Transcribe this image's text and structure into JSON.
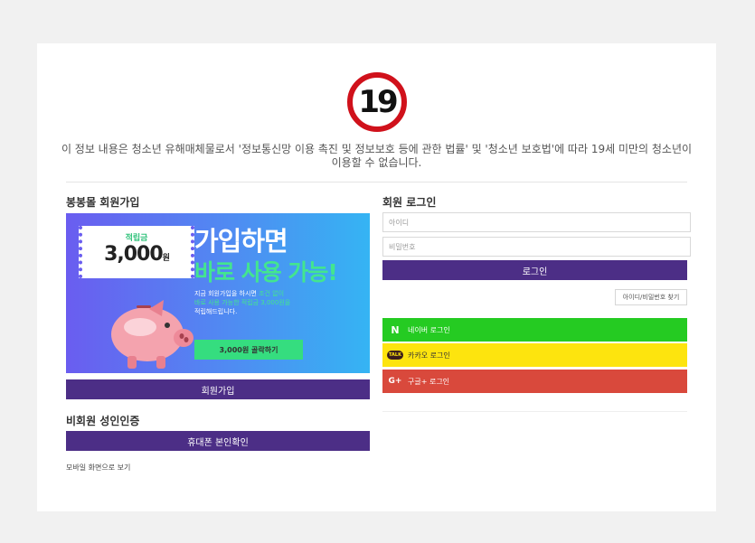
{
  "age_badge": "19",
  "notice": "이 정보 내용은 청소년 유해매체물로서 '정보통신망 이용 촉진 및 정보보호 등에 관한 법률' 및 '청소년 보호법'에 따라 19세 미만의 청소년이 이용할 수 없습니다.",
  "signup": {
    "title": "봉봉몰 회원가입",
    "banner": {
      "ticket_label": "적립금",
      "ticket_amount": "3,000",
      "ticket_unit": "원",
      "headline1": "가입하면",
      "headline2": "바로 사용 가능!",
      "desc_line1_a": "지금 회원가입을 하시면 ",
      "desc_line1_b": "조건 없이",
      "desc_line2": "바로 사용 가능한 적립금 3,000원을",
      "desc_line3": "적립해드립니다.",
      "button": "3,000원 골락하기"
    },
    "button": "회원가입"
  },
  "guest": {
    "title": "비회원 성인인증",
    "button": "휴대폰 본인확인"
  },
  "mobile_link": "모바일 화면으로 보기",
  "login": {
    "title": "회원 로그인",
    "id_placeholder": "아이디",
    "pw_placeholder": "비밀번호",
    "button": "로그인",
    "find": "아이디/비밀번호 찾기",
    "naver": "네이버 로그인",
    "kakao": "카카오 로그인",
    "google": "구글+ 로그인",
    "naver_icon": "N",
    "kakao_icon": "TALK",
    "google_icon": "G+"
  },
  "colors": {
    "purple": "#4c2e86",
    "naver": "#25cb22",
    "kakao": "#fde40e",
    "google": "#d9493c",
    "badge_red": "#d0111b"
  }
}
